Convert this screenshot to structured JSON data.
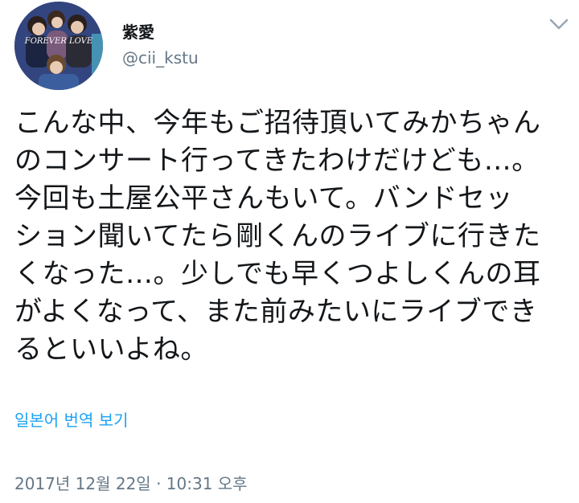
{
  "tweet": {
    "display_name": "紫愛",
    "handle": "@cii_kstu",
    "avatar_text": "FOREVER LOVE",
    "text": "こんな中、今年もご招待頂いてみかちゃん\nのコンサート行ってきたわけだけども…。\n今回も土屋公平さんもいて。バンドセッ\nション聞いてたら剛くんのライブに行きた\nくなった…。少しでも早くつよしくんの耳\nがよくなって、また前みたいにライブでき\nるといいよね。",
    "translate_label": "일본어 번역 보기",
    "timestamp": "2017년 12월 22일 · 10:31 오후"
  },
  "icons": {
    "menu": "chevron-down-icon"
  },
  "colors": {
    "text": "#14171a",
    "secondary": "#657786",
    "link": "#1da1f2",
    "background": "#ffffff"
  }
}
